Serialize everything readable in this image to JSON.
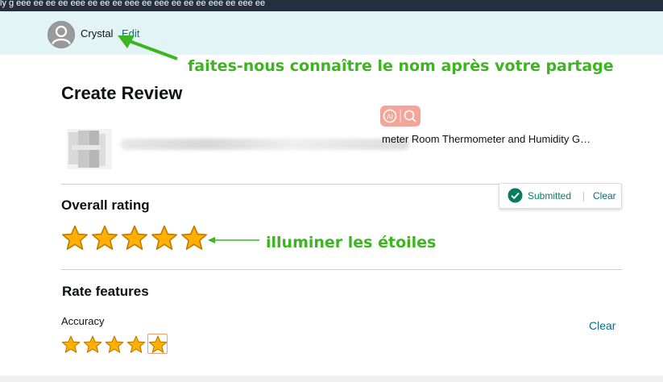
{
  "top_nav": {
    "text": "ly g  eee  ee ee  ee  eee ee ee ee  eee ee eee  ee ee ee eee  ee  eee ee"
  },
  "profile": {
    "name": "Crystal",
    "edit_label": "Edit",
    "avatar_icon": "user-silhouette-icon"
  },
  "annotations": {
    "name_note": "faites-nous connaître le nom après votre partage",
    "stars_note": "illuminer les étoiles",
    "color": "#3cb521"
  },
  "page": {
    "title": "Create Review"
  },
  "product": {
    "title": "meter Room Thermometer and Humidity G…",
    "ai_badge_icons": [
      "ai-icon",
      "search-icon"
    ]
  },
  "overall_rating": {
    "heading": "Overall rating",
    "rating": 5,
    "max": 5,
    "status": {
      "submitted_label": "Submitted",
      "separator": "|",
      "clear_label": "Clear"
    }
  },
  "rate_features": {
    "heading": "Rate features",
    "features": [
      {
        "label": "Accuracy",
        "rating": 5,
        "max": 5,
        "clear_label": "Clear"
      }
    ]
  },
  "colors": {
    "star_fill": "#ffb000",
    "star_stroke": "#c07a00",
    "link": "#007185",
    "success": "#067d62",
    "profile_bar_bg": "#e3f4f7"
  }
}
